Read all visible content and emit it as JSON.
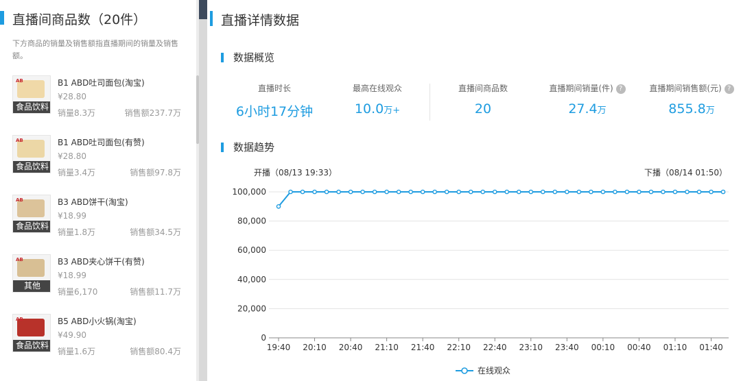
{
  "left_panel": {
    "title": "直播间商品数（20件）",
    "description": "下方商品的销量及销售额指直播期间的销量及销售额。",
    "products": [
      {
        "name": "B1 ABD吐司面包(淘宝)",
        "price": "¥28.80",
        "category": "食品饮料",
        "sales": "销量8.3万",
        "amount": "销售额237.7万",
        "brand": "AB",
        "pack_color": "#f0d9a8"
      },
      {
        "name": "B1 ABD吐司面包(有赞)",
        "price": "¥28.80",
        "category": "食品饮料",
        "sales": "销量3.4万",
        "amount": "销售额97.8万",
        "brand": "AB",
        "pack_color": "#ecd7a6"
      },
      {
        "name": "B3 ABD饼干(淘宝)",
        "price": "¥18.99",
        "category": "食品饮料",
        "sales": "销量1.8万",
        "amount": "销售额34.5万",
        "brand": "AB",
        "pack_color": "#dcc39a"
      },
      {
        "name": "B3 ABD夹心饼干(有赞)",
        "price": "¥18.99",
        "category": "其他",
        "sales": "销量6,170",
        "amount": "销售额11.7万",
        "brand": "AB",
        "pack_color": "#d8bf94"
      },
      {
        "name": "B5 ABD小火锅(淘宝)",
        "price": "¥49.90",
        "category": "食品饮料",
        "sales": "销量1.6万",
        "amount": "销售额80.4万",
        "brand": "AB",
        "pack_color": "#b8322a"
      }
    ]
  },
  "right_panel": {
    "title": "直播详情数据",
    "overview_title": "数据概览",
    "metrics": [
      {
        "label": "直播时长",
        "value": "6小时17分钟",
        "unit": "",
        "help": false
      },
      {
        "label": "最高在线观众",
        "value": "10.0",
        "unit": "万+",
        "help": false
      },
      {
        "label": "直播间商品数",
        "value": "20",
        "unit": "",
        "help": false
      },
      {
        "label": "直播期间销量(件)",
        "value": "27.4",
        "unit": "万",
        "help": true
      },
      {
        "label": "直播期间销售额(元)",
        "value": "855.8",
        "unit": "万",
        "help": true
      }
    ],
    "help_icon": "?",
    "trend_title": "数据趋势",
    "start_label": "开播（08/13 19:33）",
    "end_label": "下播（08/14 01:50）"
  },
  "colors": {
    "accent": "#1e9ce0",
    "line": "#1e9ce0",
    "grid": "#e3e3e3",
    "text_muted": "#999999"
  },
  "chart_data": {
    "type": "line",
    "categories": [
      "19:40",
      "19:50",
      "20:00",
      "20:10",
      "20:20",
      "20:30",
      "20:40",
      "20:50",
      "21:00",
      "21:10",
      "21:20",
      "21:30",
      "21:40",
      "21:50",
      "22:00",
      "22:10",
      "22:20",
      "22:30",
      "22:40",
      "22:50",
      "23:00",
      "23:10",
      "23:20",
      "23:30",
      "23:40",
      "23:50",
      "00:00",
      "00:10",
      "00:20",
      "00:30",
      "00:40",
      "00:50",
      "01:00",
      "01:10",
      "01:20",
      "01:30",
      "01:40",
      "01:50"
    ],
    "x_tick_labels": [
      "19:40",
      "20:10",
      "20:40",
      "21:10",
      "21:40",
      "22:10",
      "22:40",
      "23:10",
      "23:40",
      "00:10",
      "00:40",
      "01:10",
      "01:40"
    ],
    "series": [
      {
        "name": "在线观众",
        "values": [
          90000,
          100000,
          100000,
          100000,
          100000,
          100000,
          100000,
          100000,
          100000,
          100000,
          100000,
          100000,
          100000,
          100000,
          100000,
          100000,
          100000,
          100000,
          100000,
          100000,
          100000,
          100000,
          100000,
          100000,
          100000,
          100000,
          100000,
          100000,
          100000,
          100000,
          100000,
          100000,
          100000,
          100000,
          100000,
          100000,
          100000,
          100000
        ]
      }
    ],
    "y_ticks": [
      0,
      20000,
      40000,
      60000,
      80000,
      100000
    ],
    "y_tick_labels": [
      "0",
      "20,000",
      "40,000",
      "60,000",
      "80,000",
      "100,000"
    ],
    "ylim": [
      0,
      100000
    ],
    "grid": true,
    "legend_position": "bottom-center",
    "xlabel": "",
    "ylabel": ""
  }
}
